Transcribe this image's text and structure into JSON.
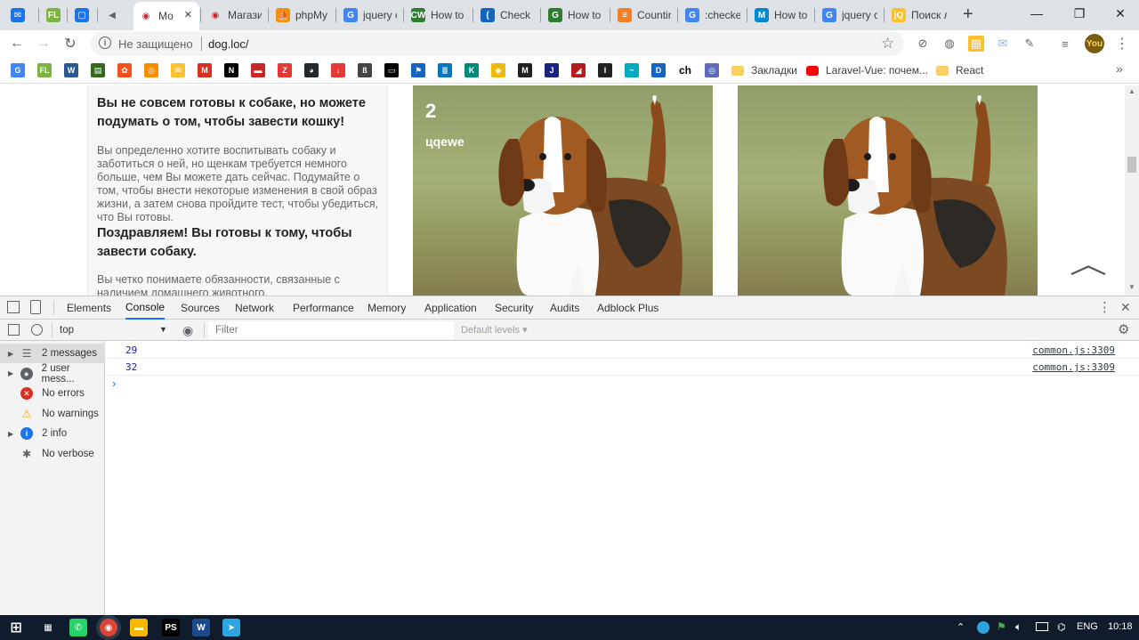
{
  "tabs": [
    {
      "label": "",
      "icon": "mail-icon",
      "color": "#1a73e8",
      "glyph": "✉"
    },
    {
      "label": "",
      "icon": "fl-icon",
      "color": "#7cb342",
      "glyph": "FL"
    },
    {
      "label": "",
      "icon": "chat-icon",
      "color": "#1a73e8",
      "glyph": "▢"
    },
    {
      "label": "",
      "icon": "audio-icon",
      "color": "#5f6368",
      "glyph": "◀"
    },
    {
      "label": "Мо",
      "icon": "eye-icon",
      "color": "#c62828",
      "glyph": "◉",
      "active": true
    },
    {
      "label": "Магази",
      "icon": "eye-icon",
      "color": "#c62828",
      "glyph": "◉"
    },
    {
      "label": "phpMy",
      "icon": "phpmyadmin-icon",
      "color": "#f29111",
      "glyph": "⛵"
    },
    {
      "label": "jquery c",
      "icon": "google-icon",
      "color": "#4285f4",
      "glyph": "G"
    },
    {
      "label": "How to",
      "icon": "cw-icon",
      "color": "#2e7d32",
      "glyph": "CW"
    },
    {
      "label": "Check if",
      "icon": "wave-icon",
      "color": "#1565c0",
      "glyph": "("
    },
    {
      "label": "How to",
      "icon": "gfg-icon",
      "color": "#2e7d32",
      "glyph": "G"
    },
    {
      "label": "Countir",
      "icon": "stackoverflow-icon",
      "color": "#f48024",
      "glyph": "≡"
    },
    {
      "label": ":checker",
      "icon": "google-icon",
      "color": "#4285f4",
      "glyph": "G"
    },
    {
      "label": "How to",
      "icon": "m-icon",
      "color": "#0288d1",
      "glyph": "M"
    },
    {
      "label": "jquery c",
      "icon": "google-icon",
      "color": "#4285f4",
      "glyph": "G"
    },
    {
      "label": "Поиск л",
      "icon": "jq-icon",
      "color": "#fbc02d",
      "glyph": "jQ"
    }
  ],
  "new_tab_glyph": "+",
  "window": {
    "minimize": "—",
    "maximize": "❐",
    "close": "✕"
  },
  "toolbar": {
    "back": "←",
    "forward": "→",
    "reload": "↻",
    "security_text": "Не защищено",
    "url": "dog.loc/",
    "star": "☆"
  },
  "bookmarks": {
    "icons": [
      {
        "name": "google-bookmark-icon",
        "glyph": "G",
        "color": "#4285f4"
      },
      {
        "name": "fl-bookmark-icon",
        "glyph": "FL",
        "color": "#7cb342"
      },
      {
        "name": "word-bookmark-icon",
        "glyph": "W",
        "color": "#2b579a"
      },
      {
        "name": "book-bookmark-icon",
        "glyph": "▤",
        "color": "#33691e"
      },
      {
        "name": "orange-bookmark-icon",
        "glyph": "✿",
        "color": "#f4511e"
      },
      {
        "name": "target-bookmark-icon",
        "glyph": "◎",
        "color": "#fb8c00"
      },
      {
        "name": "mail-bookmark-icon",
        "glyph": "✉",
        "color": "#fbc02d"
      },
      {
        "name": "gmail-bookmark-icon",
        "glyph": "M",
        "color": "#d93025"
      },
      {
        "name": "n-bookmark-icon",
        "glyph": "N",
        "color": "#000000"
      },
      {
        "name": "ticket-bookmark-icon",
        "glyph": "▬",
        "color": "#c62828"
      },
      {
        "name": "z-bookmark-icon",
        "glyph": "Z",
        "color": "#e53935"
      },
      {
        "name": "github-bookmark-icon",
        "glyph": "◕",
        "color": "#24292e"
      },
      {
        "name": "download-bookmark-icon",
        "glyph": "↓",
        "color": "#e53935"
      },
      {
        "name": "beta-bookmark-icon",
        "glyph": "ß",
        "color": "#444444"
      },
      {
        "name": "window-bookmark-icon",
        "glyph": "▭",
        "color": "#000000"
      },
      {
        "name": "flag-bookmark-icon",
        "glyph": "⚑",
        "color": "#1565c0"
      },
      {
        "name": "stack-bookmark-icon",
        "glyph": "≣",
        "color": "#0277bd"
      },
      {
        "name": "k-bookmark-icon",
        "glyph": "K",
        "color": "#00897b"
      },
      {
        "name": "binance-bookmark-icon",
        "glyph": "◆",
        "color": "#f0b90b"
      },
      {
        "name": "m-circle-bookmark-icon",
        "glyph": "M",
        "color": "#212121"
      },
      {
        "name": "j2t-bookmark-icon",
        "glyph": "J",
        "color": "#1a237e"
      },
      {
        "name": "red-bookmark-icon",
        "glyph": "◢",
        "color": "#b71c1c"
      },
      {
        "name": "inv-bookmark-icon",
        "glyph": "I",
        "color": "#212121"
      },
      {
        "name": "wave-bookmark-icon",
        "glyph": "~",
        "color": "#00acc1"
      },
      {
        "name": "d-bookmark-icon",
        "glyph": "D",
        "color": "#1565c0"
      },
      {
        "name": "ch-bookmark-icon",
        "glyph": "ch",
        "color": "#000000"
      },
      {
        "name": "globe-bookmark-icon",
        "glyph": "◎",
        "color": "#5c6bc0"
      }
    ],
    "folders": [
      "Закладки",
      "Laravel-Vue: почем...",
      "React"
    ],
    "more": "»"
  },
  "page": {
    "card_heading_1": "Вы не совсем готовы к собаке, но можете подумать о том, чтобы завести кошку!",
    "card_text_1": "Вы определенно хотите воспитывать собаку и заботиться о ней, но щенкам требуется немного больше, чем Вы можете дать сейчас. Подумайте о том, чтобы внести некоторые изменения в свой образ жизни, а затем снова пройдите тест, чтобы убедиться, что Вы готовы.",
    "card_heading_2": "Поздравляем! Вы готовы к тому, чтобы завести собаку.",
    "card_text_2": "Вы четко понимаете обязанности, связанные с наличием домашнего животного.",
    "dog_1": {
      "number": "2",
      "name": "цqewe"
    },
    "scroll_top": "︿"
  },
  "devtools": {
    "tabs": [
      "Elements",
      "Console",
      "Sources",
      "Network",
      "Performance",
      "Memory",
      "Application",
      "Security",
      "Audits",
      "Adblock Plus"
    ],
    "active_tab": "Console",
    "context": "top",
    "filter_placeholder": "Filter",
    "levels": "Default levels ▾",
    "sidebar": [
      {
        "label": "2 messages",
        "icon": "list-icon",
        "glyph": "☰",
        "color": "#5f6368",
        "arrow": true,
        "selected": true
      },
      {
        "label": "2 user mess...",
        "icon": "user-icon",
        "glyph": "●",
        "color": "#5f6368",
        "arrow": true
      },
      {
        "label": "No errors",
        "icon": "error-icon",
        "glyph": "✕",
        "color": "#d93025",
        "arrow": false
      },
      {
        "label": "No warnings",
        "icon": "warning-icon",
        "glyph": "!",
        "color": "#f2a600",
        "arrow": false
      },
      {
        "label": "2 info",
        "icon": "info-icon",
        "glyph": "i",
        "color": "#1a73e8",
        "arrow": true
      },
      {
        "label": "No verbose",
        "icon": "bug-icon",
        "glyph": "✱",
        "color": "#5f6368",
        "arrow": false
      }
    ],
    "console_rows": [
      {
        "value": "29",
        "source": "common.js:3309"
      },
      {
        "value": "32",
        "source": "common.js:3309"
      }
    ],
    "prompt": "›"
  },
  "taskbar": {
    "apps": [
      {
        "name": "start-icon",
        "glyph": "⊞",
        "color": "#101c2b"
      },
      {
        "name": "calculator-icon",
        "glyph": "▦",
        "color": "#101c2b"
      },
      {
        "name": "whatsapp-icon",
        "glyph": "✆",
        "color": "#25d366"
      },
      {
        "name": "chrome-icon",
        "glyph": "◉",
        "color": "#db4437"
      },
      {
        "name": "explorer-icon",
        "glyph": "▬",
        "color": "#f9b800"
      },
      {
        "name": "phpstorm-icon",
        "glyph": "PS",
        "color": "#000000"
      },
      {
        "name": "visio-icon",
        "glyph": "W",
        "color": "#1e4a8c"
      },
      {
        "name": "telegram-icon",
        "glyph": "➤",
        "color": "#2ca5e0"
      }
    ],
    "lang": "ENG",
    "time": "10:18"
  }
}
